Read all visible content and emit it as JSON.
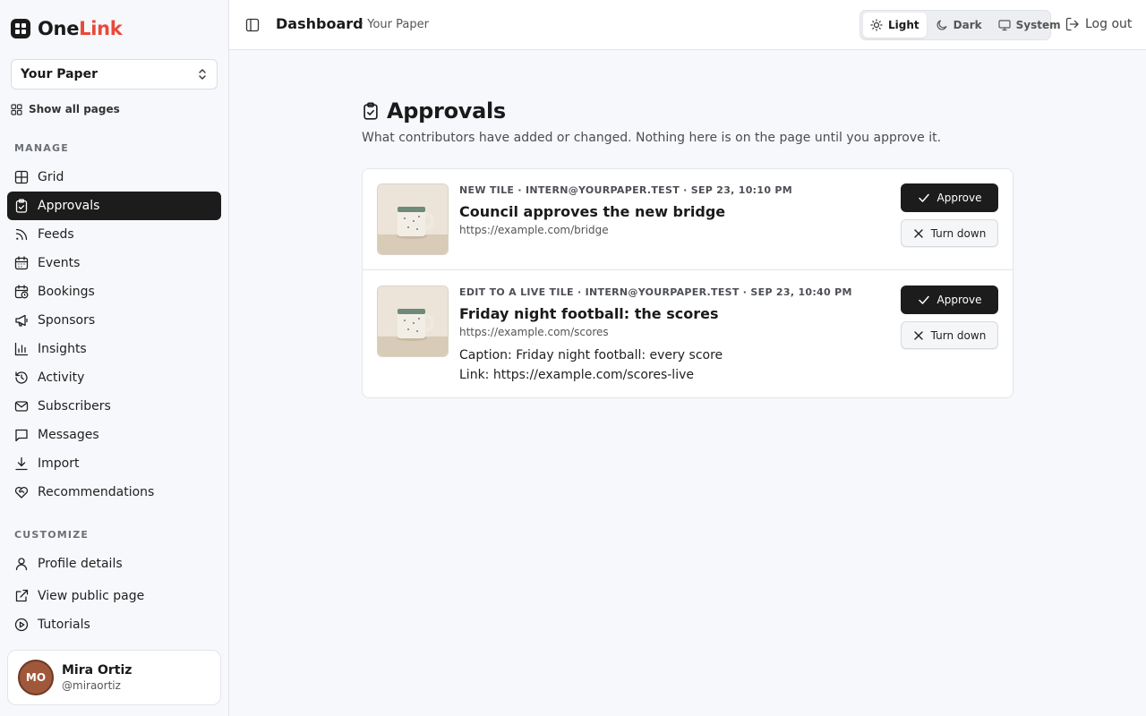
{
  "brand": {
    "name_part1": "One",
    "name_part2": "Link",
    "accent": "#e84a3a"
  },
  "sidebar": {
    "page_select": "Your Paper",
    "show_all": "Show all pages",
    "manage_label": "MANAGE",
    "manage_items": [
      {
        "label": "Grid",
        "icon": "grid-icon"
      },
      {
        "label": "Approvals",
        "icon": "clipboard-check-icon",
        "active": true
      },
      {
        "label": "Feeds",
        "icon": "rss-icon"
      },
      {
        "label": "Events",
        "icon": "calendar-icon"
      },
      {
        "label": "Bookings",
        "icon": "calendar-clock-icon"
      },
      {
        "label": "Sponsors",
        "icon": "megaphone-icon"
      },
      {
        "label": "Insights",
        "icon": "bar-chart-icon"
      },
      {
        "label": "Activity",
        "icon": "history-icon"
      },
      {
        "label": "Subscribers",
        "icon": "mail-icon"
      },
      {
        "label": "Messages",
        "icon": "message-icon"
      },
      {
        "label": "Import",
        "icon": "download-icon"
      },
      {
        "label": "Recommendations",
        "icon": "heart-handshake-icon"
      }
    ],
    "customize_label": "CUSTOMIZE",
    "customize_items": [
      {
        "label": "Profile details",
        "icon": "user-icon"
      },
      {
        "label": "View public page",
        "icon": "external-link-icon"
      },
      {
        "label": "Tutorials",
        "icon": "play-circle-icon"
      }
    ],
    "user": {
      "initials": "MO",
      "name": "Mira Ortiz",
      "handle": "@miraortiz"
    }
  },
  "topbar": {
    "title": "Dashboard",
    "subtitle": "· Your Paper",
    "themes": [
      "Light",
      "Dark",
      "System"
    ],
    "active_theme": "Light",
    "logout": "Log out"
  },
  "main": {
    "title": "Approvals",
    "description": "What contributors have added or changed. Nothing here is on the page until you approve it.",
    "items": [
      {
        "meta": "NEW TILE · INTERN@YOURPAPER.TEST · SEP 23, 10:10 PM",
        "title": "Council approves the new bridge",
        "url": "https://example.com/bridge",
        "approve": "Approve",
        "reject": "Turn down"
      },
      {
        "meta": "EDIT TO A LIVE TILE · INTERN@YOURPAPER.TEST · SEP 23, 10:40 PM",
        "title": "Friday night football: the scores",
        "url": "https://example.com/scores",
        "caption": "Caption: Friday night football: every score",
        "link": "Link: https://example.com/scores-live",
        "approve": "Approve",
        "reject": "Turn down"
      }
    ]
  }
}
